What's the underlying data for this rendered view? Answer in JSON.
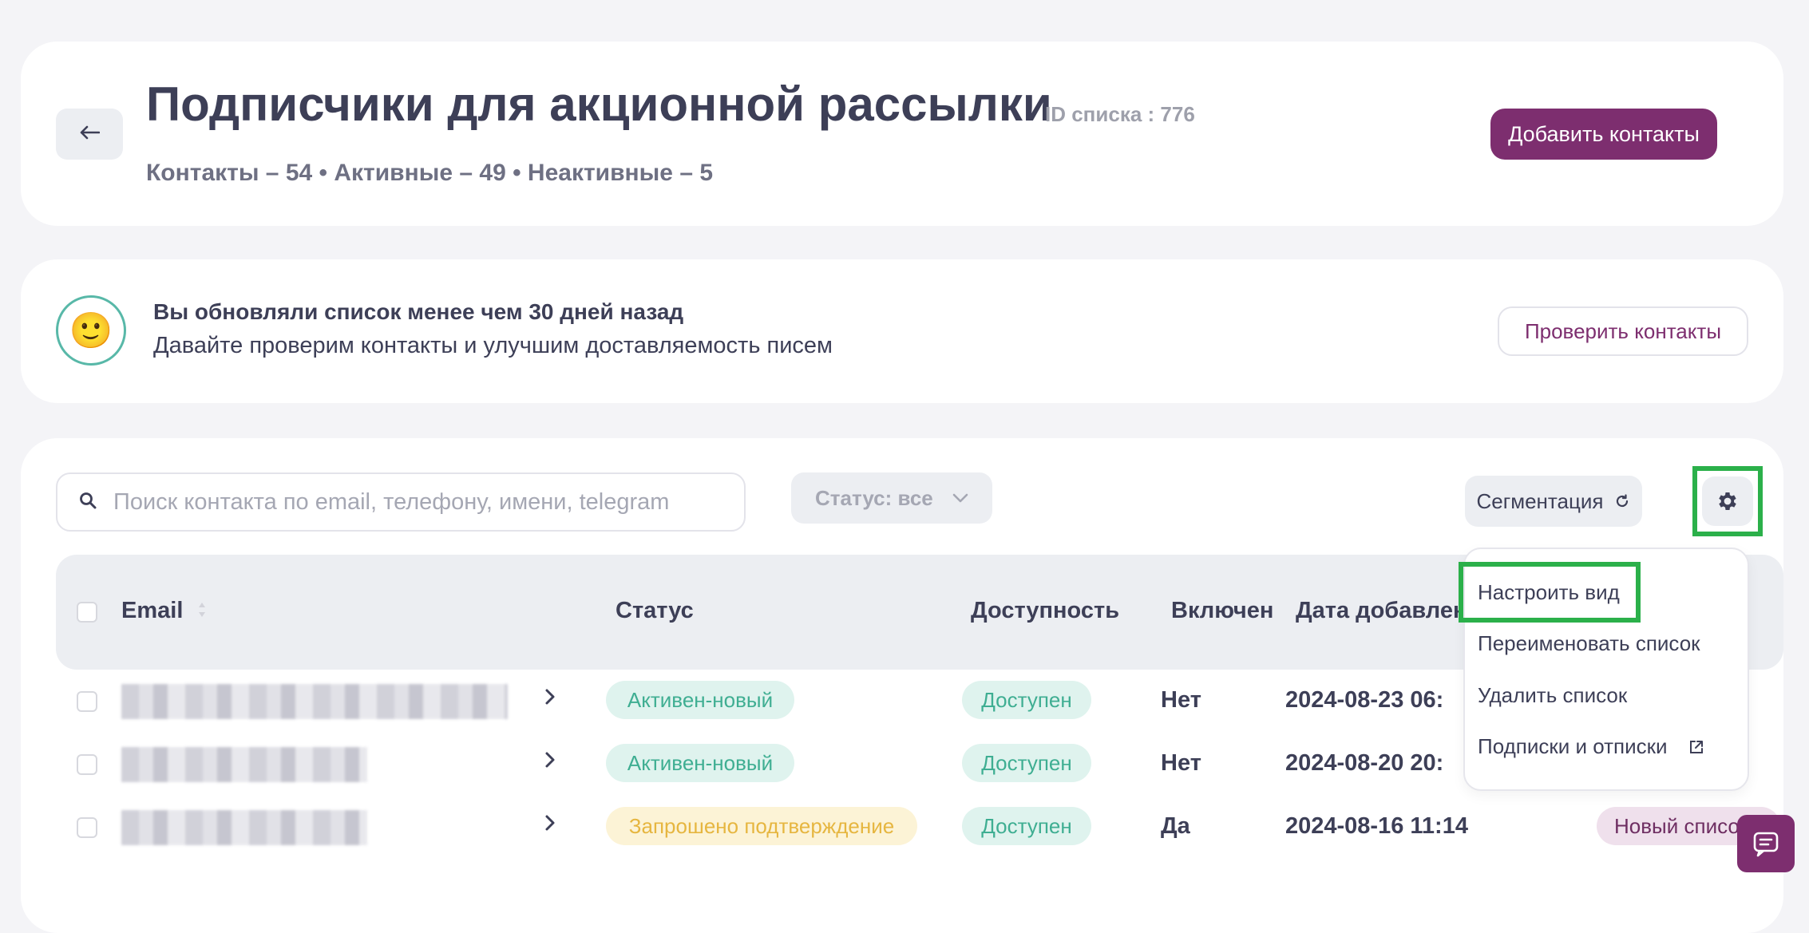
{
  "header": {
    "title": "Подписчики для акционной рассылки",
    "list_id": "ID списка : 776",
    "stats": "Контакты – 54 • Активные – 49 • Неактивные – 5",
    "add_button": "Добавить контакты",
    "back_icon": "arrow-left-icon"
  },
  "notice": {
    "emoji": "🙂",
    "title": "Вы обновляли список менее чем 30 дней назад",
    "subtitle": "Давайте проверим контакты и улучшим доставляемость писем",
    "check_button": "Проверить контакты"
  },
  "toolbar": {
    "search_placeholder": "Поиск контакта по email, телефону, имени, telegram",
    "status_filter": "Статус: все",
    "segmentation_button": "Сегментация"
  },
  "table": {
    "columns": [
      "Email",
      "Статус",
      "Доступность",
      "Включен",
      "Дата добавлени"
    ],
    "rows": [
      {
        "status": "Активен-новый",
        "status_color": "green",
        "availability": "Доступен",
        "enabled": "Нет",
        "date": "2024-08-23 06:",
        "tag": ""
      },
      {
        "status": "Активен-новый",
        "status_color": "green",
        "availability": "Доступен",
        "enabled": "Нет",
        "date": "2024-08-20 20:",
        "tag": ""
      },
      {
        "status": "Запрошено подтверждение",
        "status_color": "yellow",
        "availability": "Доступен",
        "enabled": "Да",
        "date": "2024-08-16 11:14",
        "tag": "Новый списо"
      }
    ]
  },
  "dropdown": {
    "items": [
      "Настроить вид",
      "Переименовать список",
      "Удалить список",
      "Подписки и отписки"
    ]
  },
  "colors": {
    "brand": "#7d2e6f",
    "highlight": "#2bb04a",
    "badge_green_text": "#3fae92",
    "badge_yellow_text": "#e6b640"
  }
}
